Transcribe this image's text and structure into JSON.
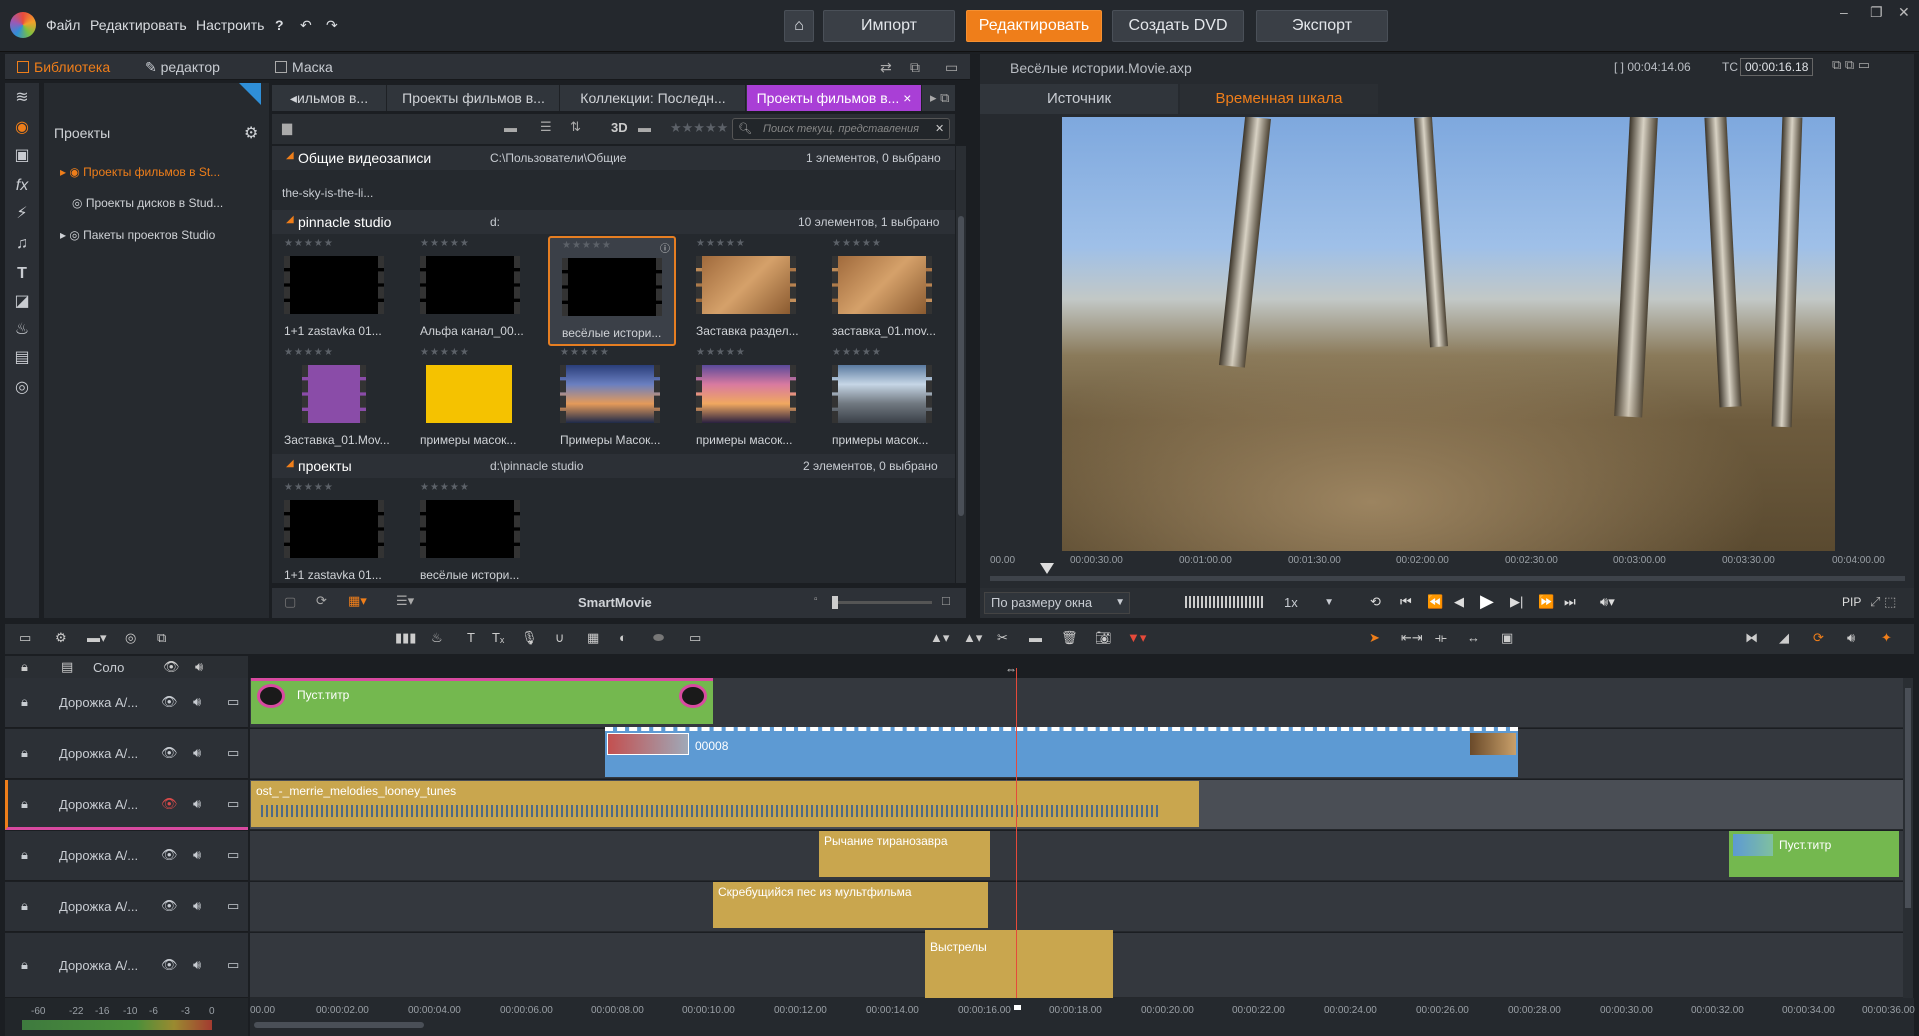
{
  "menu": {
    "file": "Файл",
    "edit": "Редактировать",
    "customize": "Настроить",
    "help": "?"
  },
  "top_tabs": [
    {
      "label": "Импорт",
      "active": false
    },
    {
      "label": "Редактировать",
      "active": true
    },
    {
      "label": "Создать DVD",
      "active": false
    },
    {
      "label": "Экспорт",
      "active": false
    }
  ],
  "library_tabs": {
    "library": "Библиотека",
    "editor": "редактор",
    "mask": "Маска"
  },
  "tree": {
    "title": "Проекты",
    "items": [
      "Проекты фильмов в St...",
      "Проекты дисков в Stud...",
      "Пакеты проектов Studio"
    ]
  },
  "collection_tabs": [
    "◂ильмов в...",
    "Проекты фильмов в...",
    "Коллекции: Последн...",
    "Проекты фильмов в..."
  ],
  "search": {
    "placeholder": "Поиск текущ. представления"
  },
  "view3d": "3D",
  "groups": [
    {
      "name": "Общие видеозаписи",
      "path": "C:\\Пользователи\\Общие",
      "count": "1 элементов, 0 выбрано"
    },
    {
      "name": "pinnacle studio",
      "path": "d:",
      "count": "10 элементов, 1 выбрано"
    },
    {
      "name": "проекты",
      "path": "d:\\pinnacle studio",
      "count": "2 элементов, 0 выбрано"
    }
  ],
  "loose_item": "the-sky-is-the-li...",
  "thumbs_row1": [
    "1+1 zastavka 01...",
    "Альфа канал_00...",
    "весёлые истори...",
    "Заставка раздел...",
    "заставка_01.mov..."
  ],
  "thumbs_row2": [
    "Заставка_01.Mov...",
    "примеры масок...",
    "Примеры Масок...",
    "примеры масок...",
    "примеры масок..."
  ],
  "thumbs_row3": [
    "1+1 zastavka 01...",
    "весёлые истори..."
  ],
  "smartmovie": "SmartMovie",
  "viewer": {
    "title": "Весёлые истории.Movie.axp",
    "duration": "[ ] 00:04:14.06",
    "tc_label": "TC",
    "tc": "00:00:16.18",
    "tab_source": "Источник",
    "tab_timeline": "Временная шкала",
    "fit": "По размеру окна",
    "speed": "1x",
    "pip": "PIP",
    "ruler": [
      "00.00",
      "00:00:30.00",
      "00:01:00.00",
      "00:01:30.00",
      "00:02:00.00",
      "00:02:30.00",
      "00:03:00.00",
      "00:03:30.00",
      "00:04:00.00"
    ]
  },
  "timeline": {
    "solo": "Соло",
    "tracks": [
      "Дорожка А/...",
      "Дорожка А/...",
      "Дорожка А/...",
      "Дорожка А/...",
      "Дорожка А/...",
      "Дорожка А/..."
    ],
    "clips": {
      "title1": "Пуст.титр",
      "video": "00008",
      "music": "ost_-_merrie_melodies_looney_tunes",
      "roar": "Рычание тиранозавра",
      "title2": "Пуст.титр",
      "dog": "Скребущийся пес из мультфильма",
      "shots": "Выстрелы"
    },
    "ticks": [
      "00.00",
      "00:00:02.00",
      "00:00:04.00",
      "00:00:06.00",
      "00:00:08.00",
      "00:00:10.00",
      "00:00:12.00",
      "00:00:14.00",
      "00:00:16.00",
      "00:00:18.00",
      "00:00:20.00",
      "00:00:22.00",
      "00:00:24.00",
      "00:00:26.00",
      "00:00:28.00",
      "00:00:30.00",
      "00:00:32.00",
      "00:00:34.00",
      "00:00:36.00"
    ],
    "meter": [
      "-60",
      "-22",
      "-16",
      "-10",
      "-6",
      "-3",
      "0"
    ]
  },
  "colors": {
    "accent": "#ef7e1a",
    "tab_purple": "#a93fd6",
    "clip_green": "#74b84f",
    "clip_blue": "#5d9ad3",
    "clip_gold": "#c9a64e",
    "playhead": "#e54a3a"
  }
}
